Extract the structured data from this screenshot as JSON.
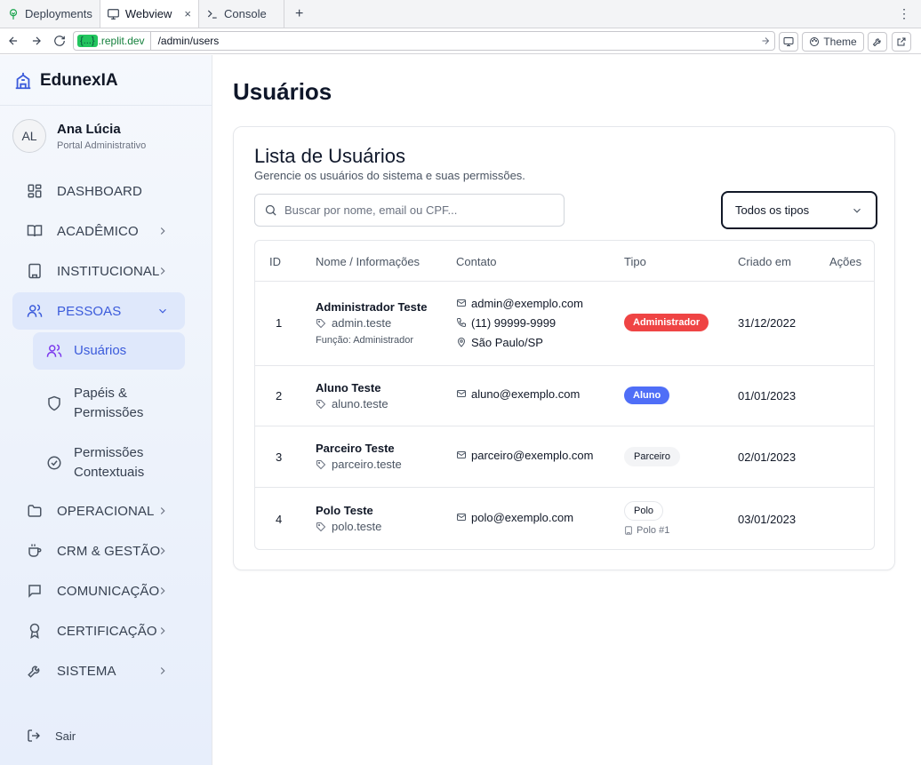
{
  "browser": {
    "tabs": [
      {
        "label": "Deployments",
        "icon": "sprout-icon"
      },
      {
        "label": "Webview",
        "icon": "monitor-icon",
        "close": "×"
      },
      {
        "label": "Console",
        "icon": "terminal-icon"
      }
    ],
    "new_tab": "+",
    "menu": "⋮",
    "url_badge": "{...}",
    "url_domain": ".replit.dev",
    "url_path": "/admin/users",
    "theme_label": "Theme"
  },
  "sidebar": {
    "brand": "EdunexIA",
    "user": {
      "initials": "AL",
      "name": "Ana Lúcia",
      "role": "Portal Administrativo"
    },
    "items": [
      {
        "label": "DASHBOARD",
        "icon": "dashboard-icon"
      },
      {
        "label": "ACADÊMICO",
        "icon": "book-icon"
      },
      {
        "label": "INSTITUCIONAL",
        "icon": "building-icon"
      },
      {
        "label": "PESSOAS",
        "icon": "users-icon"
      },
      {
        "label": "OPERACIONAL",
        "icon": "folder-icon"
      },
      {
        "label": "CRM & GESTÃO",
        "icon": "coffee-icon"
      },
      {
        "label": "COMUNICAÇÃO",
        "icon": "message-icon"
      },
      {
        "label": "CERTIFICAÇÃO",
        "icon": "award-icon"
      },
      {
        "label": "SISTEMA",
        "icon": "wrench-icon"
      }
    ],
    "subitems": [
      {
        "label": "Usuários",
        "icon": "users-icon"
      },
      {
        "label_line1": "Papéis &",
        "label_line2": "Permissões",
        "icon": "shield-icon"
      },
      {
        "label_line1": "Permissões",
        "label_line2": "Contextuais",
        "icon": "check-circle-icon"
      }
    ],
    "logout": "Sair"
  },
  "main": {
    "title": "Usuários",
    "card": {
      "title": "Lista de Usuários",
      "description": "Gerencie os usuários do sistema e suas permissões.",
      "search_placeholder": "Buscar por nome, email ou CPF...",
      "filter_value": "Todos os tipos"
    },
    "table": {
      "headers": [
        "ID",
        "Nome / Informações",
        "Contato",
        "Tipo",
        "Criado em",
        "Ações"
      ],
      "rows": [
        {
          "id": "1",
          "name": "Administrador Teste",
          "username": "admin.teste",
          "function": "Função: Administrador",
          "email": "admin@exemplo.com",
          "phone": "(11) 99999-9999",
          "location": "São Paulo/SP",
          "type": "Administrador",
          "created": "31/12/2022"
        },
        {
          "id": "2",
          "name": "Aluno Teste",
          "username": "aluno.teste",
          "email": "aluno@exemplo.com",
          "type": "Aluno",
          "created": "01/01/2023"
        },
        {
          "id": "3",
          "name": "Parceiro Teste",
          "username": "parceiro.teste",
          "email": "parceiro@exemplo.com",
          "type": "Parceiro",
          "created": "02/01/2023"
        },
        {
          "id": "4",
          "name": "Polo Teste",
          "username": "polo.teste",
          "email": "polo@exemplo.com",
          "type": "Polo",
          "polo_ref": "Polo #1",
          "created": "03/01/2023"
        }
      ]
    }
  },
  "colors": {
    "accent": "#3b5bdb",
    "admin_badge": "#ef4444",
    "aluno_badge": "#4f6ef7"
  }
}
